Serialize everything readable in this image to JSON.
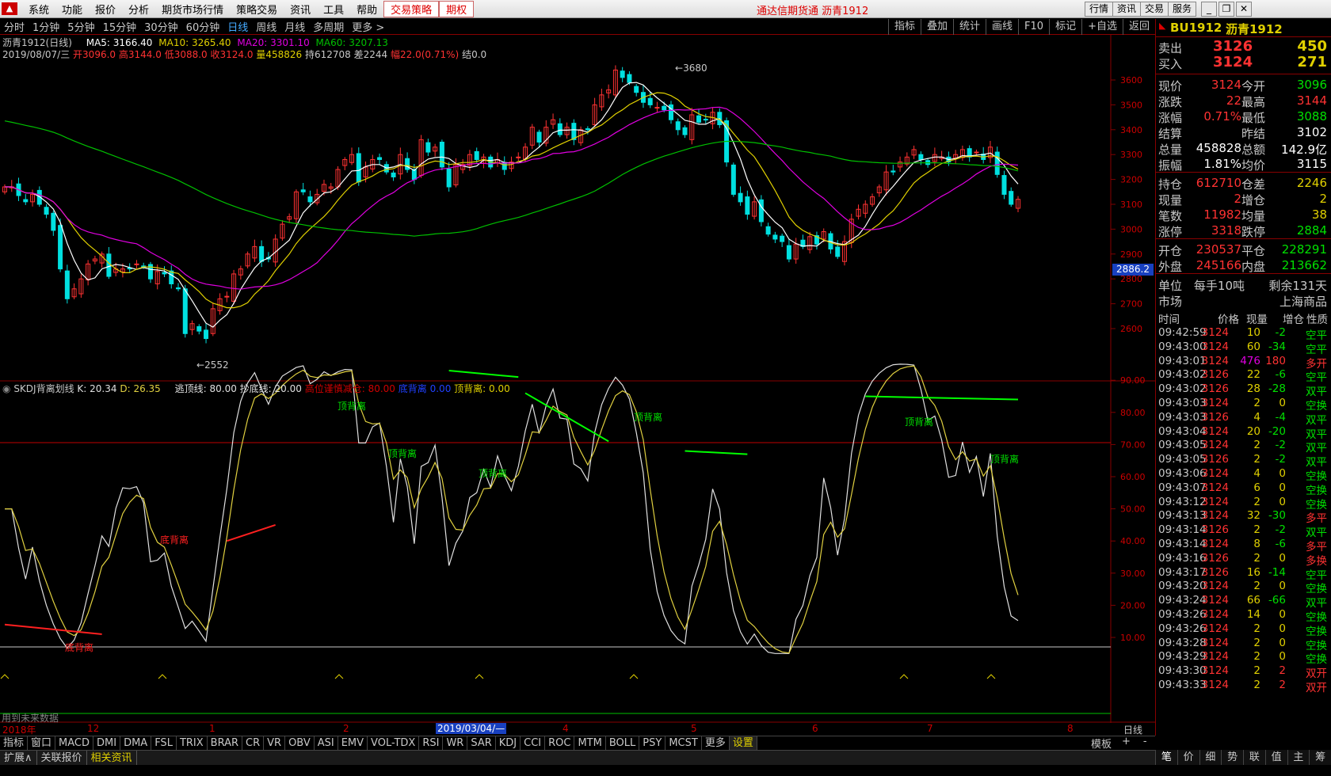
{
  "menu": {
    "items": [
      "系统",
      "功能",
      "报价",
      "分析",
      "期货市场行情",
      "策略交易",
      "资讯",
      "工具",
      "帮助"
    ],
    "hl1": "交易策略",
    "hl2": "期权",
    "center": "通达信期货通  沥青1912",
    "right_buttons": [
      "行情",
      "资讯",
      "交易",
      "服务"
    ]
  },
  "periods": {
    "items": [
      "分时",
      "1分钟",
      "5分钟",
      "15分钟",
      "30分钟",
      "60分钟",
      "日线",
      "周线",
      "月线",
      "多周期",
      "更多 >"
    ],
    "active_index": 6,
    "right": [
      "指标",
      "叠加",
      "统计",
      "画线",
      "F10",
      "标记",
      "+自选",
      "返回"
    ]
  },
  "main_info": {
    "name": "沥青1912(日线)",
    "ma5": "MA5: 3166.40",
    "ma10": "MA10: 3265.40",
    "ma20": "MA20: 3301.10",
    "ma60": "MA60: 3207.13",
    "line2_date": "2019/08/07/三",
    "open": "开3096.0",
    "high": "高3144.0",
    "low": "低3088.0",
    "close": "收3124.0",
    "vol": "量458826",
    "hold": "持612708",
    "diff": "差2244",
    "amp": "幅22.0(0.71%)",
    "settle": "结0.0"
  },
  "price_axis": [
    "3600",
    "3500",
    "3400",
    "3300",
    "3200",
    "3100",
    "3000",
    "2900",
    "2800",
    "2700",
    "2600"
  ],
  "price_box": "2886.2",
  "annot": {
    "high": "3680",
    "low": "2552"
  },
  "sub_info": {
    "title": "SKDJ背离划线",
    "k": "K: 20.34",
    "d": "D: 26.35",
    "esc": "逃顶线: 80.00",
    "buy": "抄底线: 20.00",
    "warn": "高位谨慎减仓: 80.00",
    "bottom": "底背离",
    "bottom_val": "0.00",
    "top": "顶背离: 0.00"
  },
  "sub_axis": [
    "90.00",
    "80.00",
    "70.00",
    "60.00",
    "50.00",
    "40.00",
    "30.00",
    "20.00",
    "10.00"
  ],
  "labels": {
    "top": "顶背离",
    "bottom": "底背离",
    "future": "用到未来数据"
  },
  "xaxis": {
    "start": "2018年",
    "months": [
      "12",
      "1",
      "2",
      "3",
      "4",
      "5",
      "6",
      "7",
      "8"
    ],
    "cursor": "2019/03/04/—",
    "period": "日线"
  },
  "tabs1": [
    "指标",
    "窗口",
    "MACD",
    "DMI",
    "DMA",
    "FSL",
    "TRIX",
    "BRAR",
    "CR",
    "VR",
    "OBV",
    "ASI",
    "EMV",
    "VOL-TDX",
    "RSI",
    "WR",
    "SAR",
    "KDJ",
    "CCI",
    "ROC",
    "MTM",
    "BOLL",
    "PSY",
    "MCST",
    "更多",
    "设置"
  ],
  "tabs1_right": [
    "模板",
    "+",
    "-"
  ],
  "tabs2": [
    "扩展∧",
    "关联报价",
    "相关资讯"
  ],
  "rtabs": [
    "笔",
    "价",
    "细",
    "势",
    "联",
    "值",
    "主",
    "筹"
  ],
  "quote": {
    "code": "BU1912",
    "name": "沥青1912",
    "rows": [
      {
        "l": "卖出",
        "v": "3126",
        "r": "450"
      },
      {
        "l": "买入",
        "v": "3124",
        "r": "271"
      },
      {
        "l": "现价",
        "v": "3124",
        "l2": "今开",
        "v2": "3096"
      },
      {
        "l": "涨跌",
        "v": "22",
        "l2": "最高",
        "v2": "3144"
      },
      {
        "l": "涨幅",
        "v": "0.71%",
        "l2": "最低",
        "v2": "3088"
      },
      {
        "l": "结算",
        "v": "",
        "l2": "昨结",
        "v2": "3102"
      },
      {
        "l": "总量",
        "v": "458828",
        "l2": "总额",
        "v2": "142.9亿"
      },
      {
        "l": "振幅",
        "v": "1.81%",
        "l2": "均价",
        "v2": "3115"
      },
      {
        "l": "持仓",
        "v": "612710",
        "l2": "仓差",
        "v2": "2246"
      },
      {
        "l": "现量",
        "v": "2",
        "l2": "增仓",
        "v2": "2"
      },
      {
        "l": "笔数",
        "v": "11982",
        "l2": "均量",
        "v2": "38"
      },
      {
        "l": "涨停",
        "v": "3318",
        "l2": "跌停",
        "v2": "2884"
      },
      {
        "l": "开仓",
        "v": "230537",
        "l2": "平仓",
        "v2": "228291"
      },
      {
        "l": "外盘",
        "v": "245166",
        "l2": "内盘",
        "v2": "213662"
      },
      {
        "l": "单位",
        "v": "每手10吨",
        "l2": "剩余131天",
        "v2": ""
      },
      {
        "l": "市场",
        "v": "",
        "l2": "",
        "v2": "上海商品"
      }
    ]
  },
  "ticks_header": [
    "时间",
    "价格",
    "现量",
    "增仓",
    "性质"
  ],
  "ticks": [
    [
      "09:42:59",
      "3124",
      "10",
      "-2",
      "空平"
    ],
    [
      "09:43:00",
      "3124",
      "60",
      "-34",
      "空平"
    ],
    [
      "09:43:01",
      "3124",
      "476",
      "180",
      "多开"
    ],
    [
      "09:43:02",
      "3126",
      "22",
      "-6",
      "空平"
    ],
    [
      "09:43:02",
      "3126",
      "28",
      "-28",
      "双平"
    ],
    [
      "09:43:03",
      "3124",
      "2",
      "0",
      "空换"
    ],
    [
      "09:43:03",
      "3126",
      "4",
      "-4",
      "双平"
    ],
    [
      "09:43:04",
      "3124",
      "20",
      "-20",
      "双平"
    ],
    [
      "09:43:05",
      "3124",
      "2",
      "-2",
      "双平"
    ],
    [
      "09:43:05",
      "3126",
      "2",
      "-2",
      "双平"
    ],
    [
      "09:43:06",
      "3124",
      "4",
      "0",
      "空换"
    ],
    [
      "09:43:07",
      "3124",
      "6",
      "0",
      "空换"
    ],
    [
      "09:43:12",
      "3124",
      "2",
      "0",
      "空换"
    ],
    [
      "09:43:13",
      "3124",
      "32",
      "-30",
      "多平"
    ],
    [
      "09:43:14",
      "3126",
      "2",
      "-2",
      "双平"
    ],
    [
      "09:43:14",
      "3124",
      "8",
      "-6",
      "多平"
    ],
    [
      "09:43:16",
      "3126",
      "2",
      "0",
      "多换"
    ],
    [
      "09:43:17",
      "3126",
      "16",
      "-14",
      "空平"
    ],
    [
      "09:43:20",
      "3124",
      "2",
      "0",
      "空换"
    ],
    [
      "09:43:24",
      "3124",
      "66",
      "-66",
      "双平"
    ],
    [
      "09:43:26",
      "3124",
      "14",
      "0",
      "空换"
    ],
    [
      "09:43:26",
      "3124",
      "2",
      "0",
      "空换"
    ],
    [
      "09:43:28",
      "3124",
      "2",
      "0",
      "空换"
    ],
    [
      "09:43:29",
      "3124",
      "2",
      "0",
      "空换"
    ],
    [
      "09:43:30",
      "3124",
      "2",
      "2",
      "双开"
    ],
    [
      "09:43:33",
      "3124",
      "2",
      "2",
      "双开"
    ]
  ],
  "colors": {
    "up": "#ff3232",
    "down": "#00e0e0",
    "ma5": "#ffffff",
    "ma10": "#e0d000",
    "ma20": "#e000e0",
    "ma60": "#00c000",
    "k": "#e0e0e0",
    "d": "#e0d040",
    "top_line": "#00ff00",
    "bot_line": "#ff2020",
    "ref80": "#c00000",
    "ref20": "#c8c8c8",
    "frame": "#800000",
    "accent": "#4a9fff"
  },
  "series": {
    "close": [
      3170,
      3170,
      3135,
      3110,
      3140,
      3100,
      3060,
      2995,
      2840,
      2720,
      2760,
      2800,
      2860,
      2880,
      2900,
      2810,
      2840,
      2840,
      2840,
      2860,
      2850,
      2800,
      2830,
      2820,
      2780,
      2760,
      2580,
      2620,
      2590,
      2560,
      2680,
      2720,
      2730,
      2820,
      2840,
      2900,
      2930,
      2870,
      2880,
      2960,
      3020,
      3050,
      3150,
      3150,
      3110,
      3140,
      3180,
      3170,
      3240,
      3280,
      3300,
      3190,
      3250,
      3280,
      3280,
      3230,
      3210,
      3300,
      3240,
      3200,
      3360,
      3310,
      3330,
      3250,
      3170,
      3260,
      3260,
      3300,
      3280,
      3290,
      3250,
      3280,
      3240,
      3270,
      3290,
      3330,
      3410,
      3350,
      3410,
      3440,
      3380,
      3410,
      3360,
      3400,
      3400,
      3500,
      3540,
      3560,
      3640,
      3610,
      3590,
      3550,
      3510,
      3500,
      3490,
      3480,
      3440,
      3400,
      3380,
      3460,
      3430,
      3440,
      3470,
      3420,
      3270,
      3140,
      3110,
      3060,
      3110,
      3030,
      2980,
      2960,
      2950,
      2880,
      2940,
      2930,
      2970,
      2940,
      2990,
      2920,
      2890,
      2950,
      3040,
      3080,
      3100,
      3130,
      3170,
      3230,
      3230,
      3270,
      3290,
      3320,
      3280,
      3260,
      3300,
      3290,
      3270,
      3300,
      3320,
      3290,
      3310,
      3280,
      3330,
      3220,
      3140,
      3100,
      3120
    ]
  }
}
